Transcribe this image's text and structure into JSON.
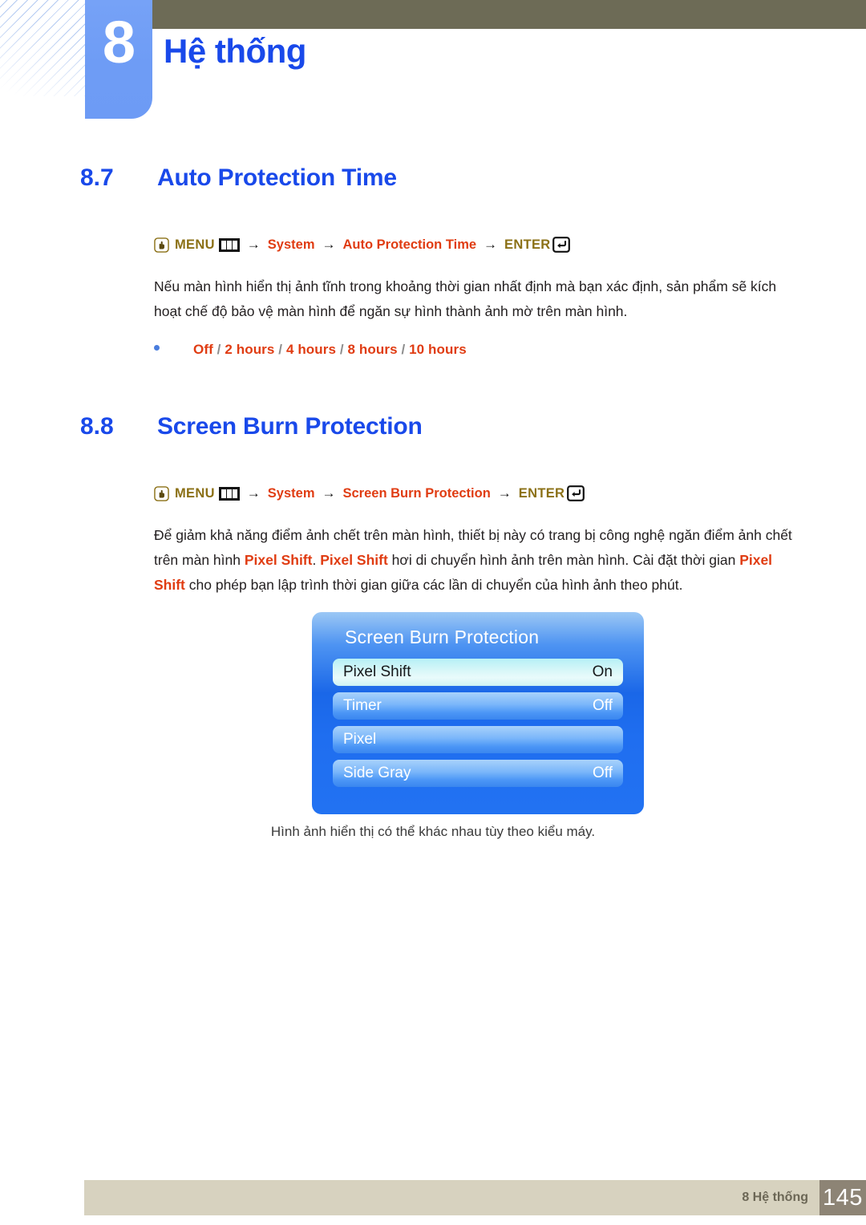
{
  "header": {
    "chapter_number": "8",
    "chapter_title": "Hệ thống"
  },
  "sections": [
    {
      "number": "8.7",
      "title": "Auto Protection Time",
      "breadcrumb": {
        "menu_label": "MENU",
        "arrow": "→",
        "path": [
          "System",
          "Auto Protection Time"
        ],
        "enter_label": "ENTER",
        "menu_icon": "hand-press-icon",
        "bars_icon": "menu-bars-icon",
        "enter_icon": "enter-return-icon"
      },
      "paragraph": "Nếu màn hình hiển thị ảnh tĩnh trong khoảng thời gian nhất định mà bạn xác định, sản phẩm sẽ kích hoạt chế độ bảo vệ màn hình để ngăn sự hình thành ảnh mờ trên màn hình.",
      "options": [
        "Off",
        "2 hours",
        "4 hours",
        "8 hours",
        "10 hours"
      ],
      "option_separator": "/"
    },
    {
      "number": "8.8",
      "title": "Screen Burn Protection",
      "breadcrumb": {
        "menu_label": "MENU",
        "arrow": "→",
        "path": [
          "System",
          "Screen Burn Protection"
        ],
        "enter_label": "ENTER",
        "menu_icon": "hand-press-icon",
        "bars_icon": "menu-bars-icon",
        "enter_icon": "enter-return-icon"
      },
      "paragraph_parts": [
        {
          "text": "Để giảm khả năng điểm ảnh chết trên màn hình, thiết bị này có trang bị công nghệ ngăn điểm ảnh chết trên màn hình ",
          "bold": false
        },
        {
          "text": "Pixel Shift",
          "bold": true
        },
        {
          "text": ". ",
          "bold": false
        },
        {
          "text": "Pixel Shift",
          "bold": true
        },
        {
          "text": " hơi di chuyển hình ảnh trên màn hình. Cài đặt thời gian ",
          "bold": false
        },
        {
          "text": "Pixel Shift",
          "bold": true
        },
        {
          "text": " cho phép bạn lập trình thời gian giữa các lần di chuyển của hình ảnh theo phút.",
          "bold": false
        }
      ]
    }
  ],
  "osd": {
    "title": "Screen Burn Protection",
    "rows": [
      {
        "label": "Pixel Shift",
        "value": "On",
        "selected": true
      },
      {
        "label": "Timer",
        "value": "Off",
        "selected": false
      },
      {
        "label": "Pixel",
        "value": "",
        "selected": false
      },
      {
        "label": "Side Gray",
        "value": "Off",
        "selected": false
      }
    ]
  },
  "osd_caption": "Hình ảnh hiển thị có thể khác nhau tùy theo kiểu máy.",
  "footer": {
    "label": "8 Hệ thống",
    "page_number": "145"
  },
  "colors": {
    "heading_blue": "#1949ea",
    "accent_orange": "#e03c12",
    "menu_gold": "#8b7016",
    "olive_bar": "#6d6b56",
    "tab_blue": "#6e9cf5",
    "footer_beige": "#d7d2bf",
    "footer_page_box": "#8d8475"
  }
}
